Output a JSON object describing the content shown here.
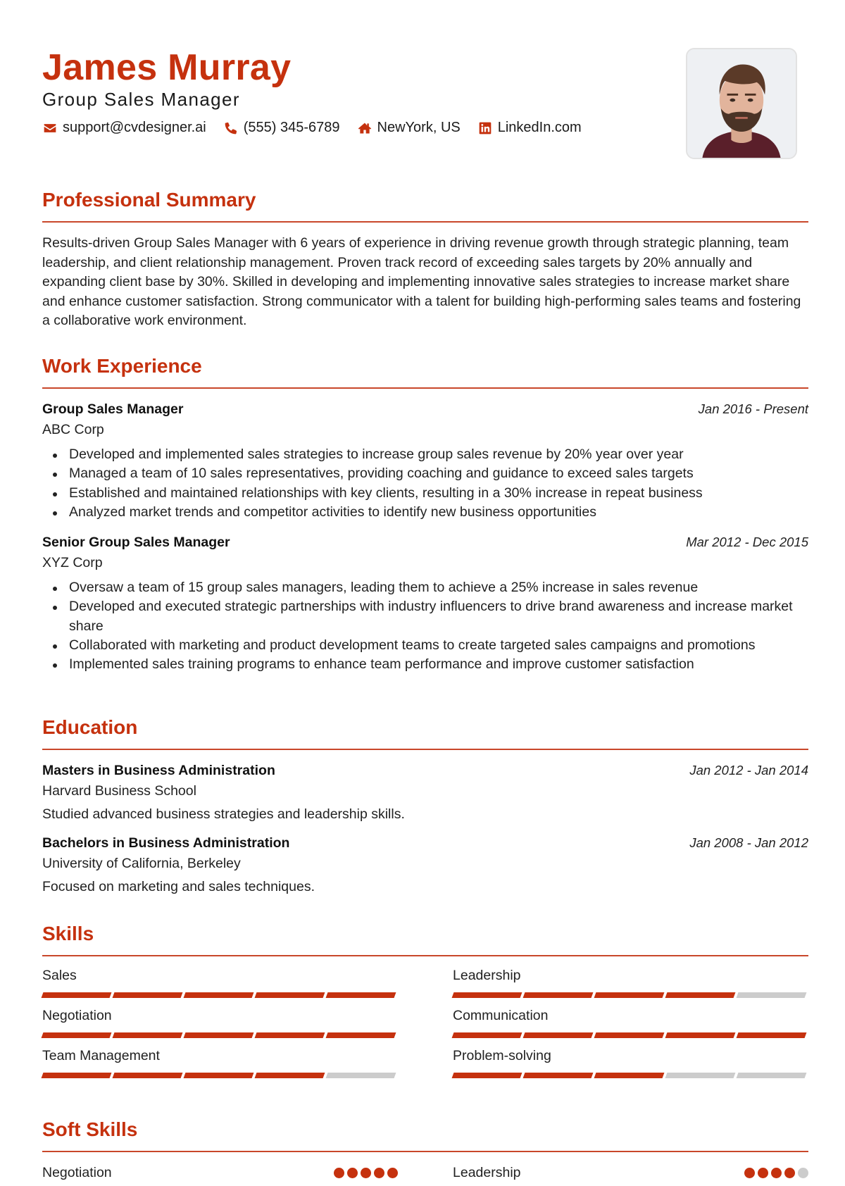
{
  "header": {
    "name": "James Murray",
    "title": "Group Sales Manager",
    "contacts": [
      {
        "icon": "envelope-icon",
        "text": "support@cvdesigner.ai"
      },
      {
        "icon": "phone-icon",
        "text": "(555) 345-6789"
      },
      {
        "icon": "home-icon",
        "text": "NewYork, US"
      },
      {
        "icon": "linkedin-icon",
        "text": "LinkedIn.com"
      }
    ],
    "photo_alt": "Profile photo"
  },
  "colors": {
    "accent": "#c5310e",
    "rule": "#c9472a",
    "inactive": "#cccccc",
    "text": "#222222"
  },
  "summary": {
    "heading": "Professional Summary",
    "text": "Results-driven Group Sales Manager with 6 years of experience in driving revenue growth through strategic planning, team leadership, and client relationship management. Proven track record of exceeding sales targets by 20% annually and expanding client base by 30%. Skilled in developing and implementing innovative sales strategies to increase market share and enhance customer satisfaction. Strong communicator with a talent for building high-performing sales teams and fostering a collaborative work environment."
  },
  "experience": {
    "heading": "Work Experience",
    "items": [
      {
        "role": "Group Sales Manager",
        "company": "ABC Corp",
        "dates": "Jan 2016 - Present",
        "bullets": [
          "Developed and implemented sales strategies to increase group sales revenue by 20% year over year",
          "Managed a team of 10 sales representatives, providing coaching and guidance to exceed sales targets",
          "Established and maintained relationships with key clients, resulting in a 30% increase in repeat business",
          "Analyzed market trends and competitor activities to identify new business opportunities"
        ]
      },
      {
        "role": "Senior Group Sales Manager",
        "company": "XYZ Corp",
        "dates": "Mar 2012 - Dec 2015",
        "bullets": [
          "Oversaw a team of 15 group sales managers, leading them to achieve a 25% increase in sales revenue",
          "Developed and executed strategic partnerships with industry influencers to drive brand awareness and increase market share",
          "Collaborated with marketing and product development teams to create targeted sales campaigns and promotions",
          "Implemented sales training programs to enhance team performance and improve customer satisfaction"
        ]
      }
    ]
  },
  "education": {
    "heading": "Education",
    "items": [
      {
        "degree": "Masters in Business Administration",
        "school": "Harvard Business School",
        "dates": "Jan 2012 - Jan 2014",
        "description": "Studied advanced business strategies and leadership skills."
      },
      {
        "degree": "Bachelors in Business Administration",
        "school": "University of California, Berkeley",
        "dates": "Jan 2008 - Jan 2012",
        "description": "Focused on marketing and sales techniques."
      }
    ]
  },
  "skills": {
    "heading": "Skills",
    "max_level": 5,
    "items": [
      {
        "name": "Sales",
        "level": 5
      },
      {
        "name": "Leadership",
        "level": 4
      },
      {
        "name": "Negotiation",
        "level": 5
      },
      {
        "name": "Communication",
        "level": 5
      },
      {
        "name": "Team Management",
        "level": 4
      },
      {
        "name": "Problem-solving",
        "level": 3
      }
    ]
  },
  "soft_skills": {
    "heading": "Soft Skills",
    "max_level": 5,
    "items": [
      {
        "name": "Negotiation",
        "level": 5
      },
      {
        "name": "Leadership",
        "level": 4
      }
    ]
  }
}
